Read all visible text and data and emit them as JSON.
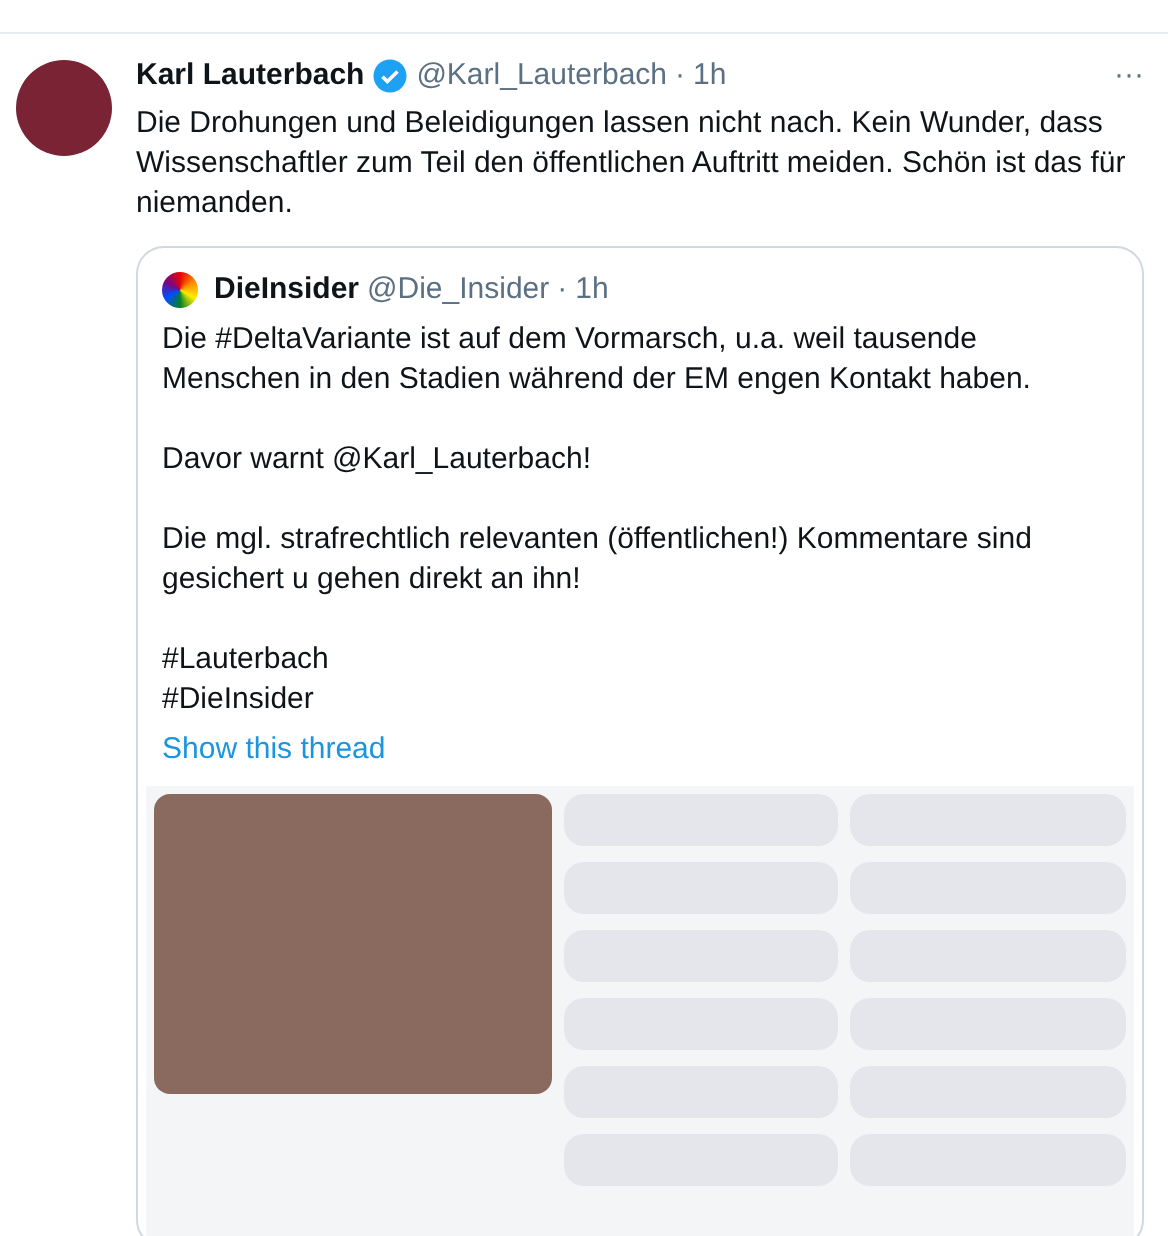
{
  "tweet": {
    "author": "Karl Lauterbach",
    "verified": true,
    "handle": "@Karl_Lauterbach",
    "separator": "·",
    "time": "1h",
    "more": "···",
    "text": "Die Drohungen und Beleidigungen lassen nicht nach. Kein Wunder, dass Wissenschaftler zum Teil den öffentlichen Auftritt meiden. Schön ist das für niemanden."
  },
  "quoted_tweet": {
    "author": "DieInsider",
    "handle": "@Die_Insider",
    "separator": "·",
    "time": "1h",
    "paragraphs": [
      "Die #DeltaVariante ist auf dem Vormarsch, u.a. weil tausende Menschen in den Stadien während der EM engen Kontakt haben.",
      "Davor warnt @Karl_Lauterbach!",
      "Die mgl. strafrechtlich relevanten (öffentlichen!) Kommentare sind gesichert u gehen direkt an ihn!",
      "#Lauterbach\n#DieInsider"
    ],
    "show_thread": "Show this thread"
  }
}
